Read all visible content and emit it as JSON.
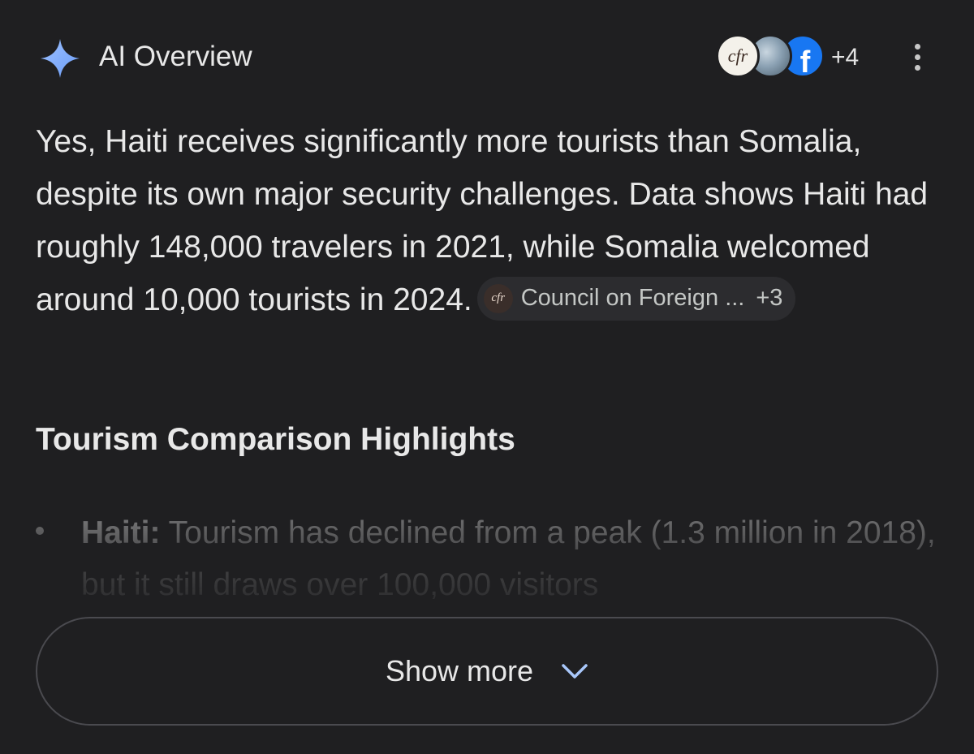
{
  "header": {
    "title": "AI Overview",
    "sources": {
      "icons": [
        "cfr-logo",
        "globe-logo",
        "facebook-logo"
      ],
      "cfr_logo_text": "cfr",
      "fb_logo_text": "f",
      "more_count": "+4"
    },
    "accent_color": "#8ab4f8"
  },
  "summary": {
    "text": "Yes, Haiti receives significantly more tourists than Somalia, despite its own major security challenges. Data shows Haiti had roughly 148,000 travelers in 2021, while Somalia welcomed around 10,000 tourists in 2024.",
    "chip": {
      "logo_text": "cfr",
      "label": "Council on Foreign ...",
      "more": "+3"
    }
  },
  "section": {
    "title": "Tourism Comparison Highlights",
    "bullets": [
      {
        "label": "Haiti:",
        "text": " Tourism has declined from a peak (1.3 million in 2018), but it still draws over 100,000 visitors"
      }
    ]
  },
  "show_more": {
    "label": "Show more"
  }
}
